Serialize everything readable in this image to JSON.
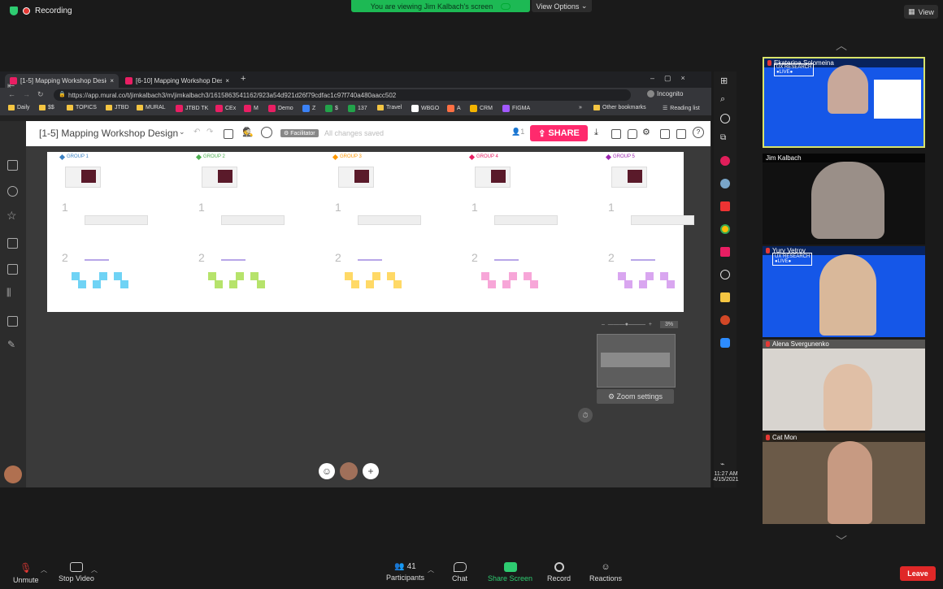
{
  "zoom": {
    "recording_label": "Recording",
    "viewing_banner": "You are viewing Jim Kalbach's screen",
    "view_options": "View Options",
    "view_label": "View"
  },
  "browser": {
    "tabs": [
      {
        "label": "[1-5] Mapping Workshop Design"
      },
      {
        "label": "[6-10] Mapping Workshop Design"
      }
    ],
    "url": "https://app.mural.co/t/jimkalbach3/m/jimkalbach3/1615863541162/923a54d921d26f79cdfac1c97f740a480aacc502",
    "incognito": "Incognito",
    "bookmarks": [
      "Daily",
      "$$",
      "TOPICS",
      "JTBD",
      "MURAL",
      "JTBD TK",
      "CEx",
      "M",
      "Demo",
      "Z",
      "$",
      "137",
      "Travel",
      "WBGO",
      "A",
      "CRM",
      "FIGMA"
    ],
    "other_bookmarks": "Other bookmarks",
    "reading_list": "Reading list"
  },
  "mural": {
    "title": "[1-5] Mapping Workshop Design",
    "facilitator": "Facilitator",
    "saved_status": "All changes saved",
    "share_label": "SHARE",
    "participant_count": "1",
    "zoom_settings": "Zoom settings",
    "zoom_level": "3%",
    "groups": [
      {
        "label": "GROUP 1",
        "color": "#3b82c4"
      },
      {
        "label": "GROUP 2",
        "color": "#4caf50"
      },
      {
        "label": "GROUP 3",
        "color": "#ff9800"
      },
      {
        "label": "GROUP 4",
        "color": "#e91e63"
      },
      {
        "label": "GROUP 5",
        "color": "#9c27b0"
      }
    ],
    "sticky_colors": [
      "#6fd3f5",
      "#b6e36b",
      "#ffd966",
      "#f7a6d8",
      "#d9a6f0"
    ]
  },
  "clock": {
    "time": "11:27 AM",
    "date": "4/15/2021"
  },
  "participants": [
    {
      "name": "Ekaterina Solomeina",
      "active": true
    },
    {
      "name": "Jim Kalbach",
      "active": false
    },
    {
      "name": "Yury Vetrov",
      "active": false
    },
    {
      "name": "Alena Svergunenko",
      "active": false
    },
    {
      "name": "Cat Mon",
      "active": false
    }
  ],
  "bottom_bar": {
    "unmute": "Unmute",
    "stop_video": "Stop Video",
    "participants": "Participants",
    "participants_count": "41",
    "chat": "Chat",
    "share_screen": "Share Screen",
    "record": "Record",
    "reactions": "Reactions",
    "leave": "Leave"
  }
}
